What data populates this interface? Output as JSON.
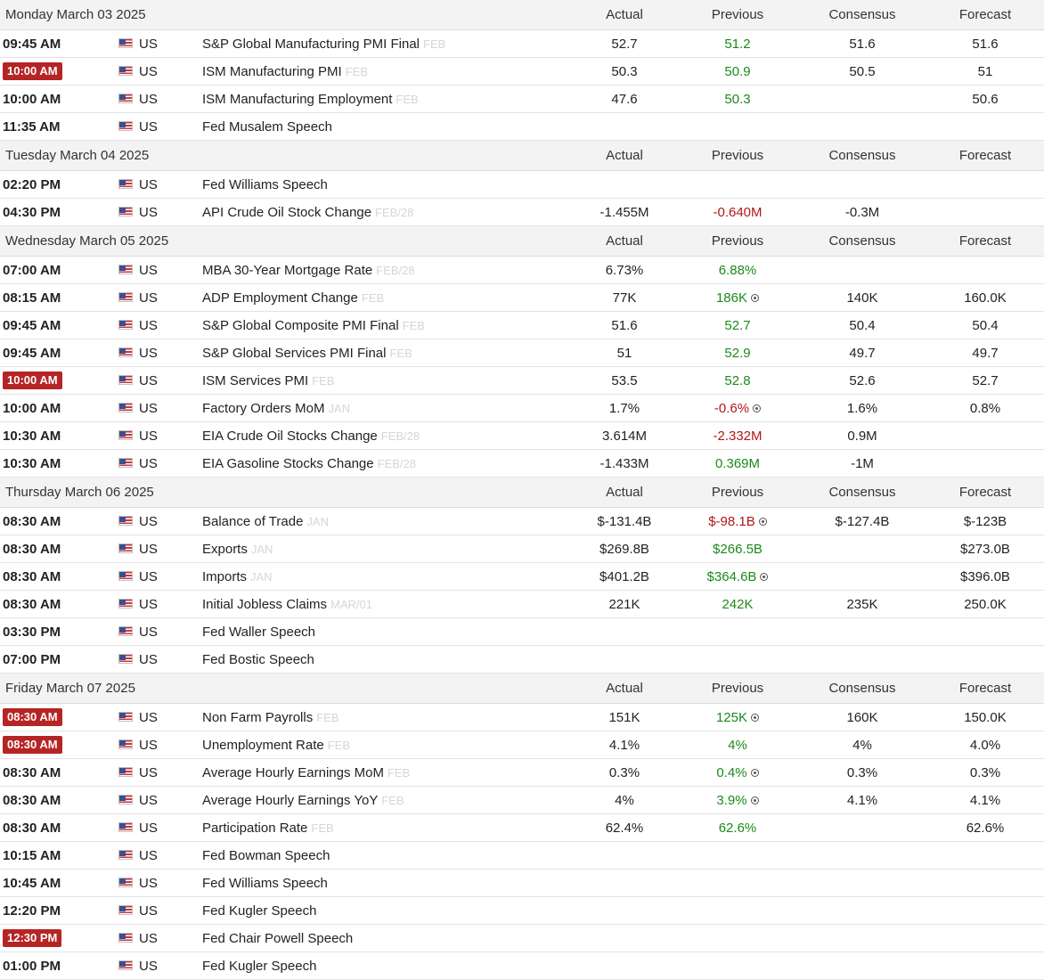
{
  "columns": {
    "actual": "Actual",
    "previous": "Previous",
    "consensus": "Consensus",
    "forecast": "Forecast"
  },
  "colors": {
    "highlight": "#b52525",
    "positive": "#1b8a1b",
    "negative": "#b01717"
  },
  "days": [
    {
      "date": "Monday March 03 2025",
      "events": [
        {
          "time": "09:45 AM",
          "highlight": false,
          "country": "US",
          "event": "S&P Global Manufacturing PMI Final",
          "ref": "FEB",
          "actual": "52.7",
          "previous": "51.2",
          "previous_color": "pos",
          "revised": false,
          "consensus": "51.6",
          "forecast": "51.6"
        },
        {
          "time": "10:00 AM",
          "highlight": true,
          "country": "US",
          "event": "ISM Manufacturing PMI",
          "ref": "FEB",
          "actual": "50.3",
          "previous": "50.9",
          "previous_color": "pos",
          "revised": false,
          "consensus": "50.5",
          "forecast": "51"
        },
        {
          "time": "10:00 AM",
          "highlight": false,
          "country": "US",
          "event": "ISM Manufacturing Employment",
          "ref": "FEB",
          "actual": "47.6",
          "previous": "50.3",
          "previous_color": "pos",
          "revised": false,
          "consensus": "",
          "forecast": "50.6"
        },
        {
          "time": "11:35 AM",
          "highlight": false,
          "country": "US",
          "event": "Fed Musalem Speech",
          "ref": "",
          "actual": "",
          "previous": "",
          "previous_color": "",
          "revised": false,
          "consensus": "",
          "forecast": ""
        }
      ]
    },
    {
      "date": "Tuesday March 04 2025",
      "events": [
        {
          "time": "02:20 PM",
          "highlight": false,
          "country": "US",
          "event": "Fed Williams Speech",
          "ref": "",
          "actual": "",
          "previous": "",
          "previous_color": "",
          "revised": false,
          "consensus": "",
          "forecast": ""
        },
        {
          "time": "04:30 PM",
          "highlight": false,
          "country": "US",
          "event": "API Crude Oil Stock Change",
          "ref": "FEB/28",
          "actual": "-1.455M",
          "previous": "-0.640M",
          "previous_color": "neg",
          "revised": false,
          "consensus": "-0.3M",
          "forecast": ""
        }
      ]
    },
    {
      "date": "Wednesday March 05 2025",
      "events": [
        {
          "time": "07:00 AM",
          "highlight": false,
          "country": "US",
          "event": "MBA 30-Year Mortgage Rate",
          "ref": "FEB/28",
          "actual": "6.73%",
          "previous": "6.88%",
          "previous_color": "pos",
          "revised": false,
          "consensus": "",
          "forecast": ""
        },
        {
          "time": "08:15 AM",
          "highlight": false,
          "country": "US",
          "event": "ADP Employment Change",
          "ref": "FEB",
          "actual": "77K",
          "previous": "186K",
          "previous_color": "pos",
          "revised": true,
          "consensus": "140K",
          "forecast": "160.0K"
        },
        {
          "time": "09:45 AM",
          "highlight": false,
          "country": "US",
          "event": "S&P Global Composite PMI Final",
          "ref": "FEB",
          "actual": "51.6",
          "previous": "52.7",
          "previous_color": "pos",
          "revised": false,
          "consensus": "50.4",
          "forecast": "50.4"
        },
        {
          "time": "09:45 AM",
          "highlight": false,
          "country": "US",
          "event": "S&P Global Services PMI Final",
          "ref": "FEB",
          "actual": "51",
          "previous": "52.9",
          "previous_color": "pos",
          "revised": false,
          "consensus": "49.7",
          "forecast": "49.7"
        },
        {
          "time": "10:00 AM",
          "highlight": true,
          "country": "US",
          "event": "ISM Services PMI",
          "ref": "FEB",
          "actual": "53.5",
          "previous": "52.8",
          "previous_color": "pos",
          "revised": false,
          "consensus": "52.6",
          "forecast": "52.7"
        },
        {
          "time": "10:00 AM",
          "highlight": false,
          "country": "US",
          "event": "Factory Orders MoM",
          "ref": "JAN",
          "actual": "1.7%",
          "previous": "-0.6%",
          "previous_color": "neg",
          "revised": true,
          "consensus": "1.6%",
          "forecast": "0.8%"
        },
        {
          "time": "10:30 AM",
          "highlight": false,
          "country": "US",
          "event": "EIA Crude Oil Stocks Change",
          "ref": "FEB/28",
          "actual": "3.614M",
          "previous": "-2.332M",
          "previous_color": "neg",
          "revised": false,
          "consensus": "0.9M",
          "forecast": ""
        },
        {
          "time": "10:30 AM",
          "highlight": false,
          "country": "US",
          "event": "EIA Gasoline Stocks Change",
          "ref": "FEB/28",
          "actual": "-1.433M",
          "previous": "0.369M",
          "previous_color": "pos",
          "revised": false,
          "consensus": "-1M",
          "forecast": ""
        }
      ]
    },
    {
      "date": "Thursday March 06 2025",
      "events": [
        {
          "time": "08:30 AM",
          "highlight": false,
          "country": "US",
          "event": "Balance of Trade",
          "ref": "JAN",
          "actual": "$-131.4B",
          "previous": "$-98.1B",
          "previous_color": "neg",
          "revised": true,
          "consensus": "$-127.4B",
          "forecast": "$-123B"
        },
        {
          "time": "08:30 AM",
          "highlight": false,
          "country": "US",
          "event": "Exports",
          "ref": "JAN",
          "actual": "$269.8B",
          "previous": "$266.5B",
          "previous_color": "pos",
          "revised": false,
          "consensus": "",
          "forecast": "$273.0B"
        },
        {
          "time": "08:30 AM",
          "highlight": false,
          "country": "US",
          "event": "Imports",
          "ref": "JAN",
          "actual": "$401.2B",
          "previous": "$364.6B",
          "previous_color": "pos",
          "revised": true,
          "consensus": "",
          "forecast": "$396.0B"
        },
        {
          "time": "08:30 AM",
          "highlight": false,
          "country": "US",
          "event": "Initial Jobless Claims",
          "ref": "MAR/01",
          "actual": "221K",
          "previous": "242K",
          "previous_color": "pos",
          "revised": false,
          "consensus": "235K",
          "forecast": "250.0K"
        },
        {
          "time": "03:30 PM",
          "highlight": false,
          "country": "US",
          "event": "Fed Waller Speech",
          "ref": "",
          "actual": "",
          "previous": "",
          "previous_color": "",
          "revised": false,
          "consensus": "",
          "forecast": ""
        },
        {
          "time": "07:00 PM",
          "highlight": false,
          "country": "US",
          "event": "Fed Bostic Speech",
          "ref": "",
          "actual": "",
          "previous": "",
          "previous_color": "",
          "revised": false,
          "consensus": "",
          "forecast": ""
        }
      ]
    },
    {
      "date": "Friday March 07 2025",
      "events": [
        {
          "time": "08:30 AM",
          "highlight": true,
          "country": "US",
          "event": "Non Farm Payrolls",
          "ref": "FEB",
          "actual": "151K",
          "previous": "125K",
          "previous_color": "pos",
          "revised": true,
          "consensus": "160K",
          "forecast": "150.0K"
        },
        {
          "time": "08:30 AM",
          "highlight": true,
          "country": "US",
          "event": "Unemployment Rate",
          "ref": "FEB",
          "actual": "4.1%",
          "previous": "4%",
          "previous_color": "pos",
          "revised": false,
          "consensus": "4%",
          "forecast": "4.0%"
        },
        {
          "time": "08:30 AM",
          "highlight": false,
          "country": "US",
          "event": "Average Hourly Earnings MoM",
          "ref": "FEB",
          "actual": "0.3%",
          "previous": "0.4%",
          "previous_color": "pos",
          "revised": true,
          "consensus": "0.3%",
          "forecast": "0.3%"
        },
        {
          "time": "08:30 AM",
          "highlight": false,
          "country": "US",
          "event": "Average Hourly Earnings YoY",
          "ref": "FEB",
          "actual": "4%",
          "previous": "3.9%",
          "previous_color": "pos",
          "revised": true,
          "consensus": "4.1%",
          "forecast": "4.1%"
        },
        {
          "time": "08:30 AM",
          "highlight": false,
          "country": "US",
          "event": "Participation Rate",
          "ref": "FEB",
          "actual": "62.4%",
          "previous": "62.6%",
          "previous_color": "pos",
          "revised": false,
          "consensus": "",
          "forecast": "62.6%"
        },
        {
          "time": "10:15 AM",
          "highlight": false,
          "country": "US",
          "event": "Fed Bowman Speech",
          "ref": "",
          "actual": "",
          "previous": "",
          "previous_color": "",
          "revised": false,
          "consensus": "",
          "forecast": ""
        },
        {
          "time": "10:45 AM",
          "highlight": false,
          "country": "US",
          "event": "Fed Williams Speech",
          "ref": "",
          "actual": "",
          "previous": "",
          "previous_color": "",
          "revised": false,
          "consensus": "",
          "forecast": ""
        },
        {
          "time": "12:20 PM",
          "highlight": false,
          "country": "US",
          "event": "Fed Kugler Speech",
          "ref": "",
          "actual": "",
          "previous": "",
          "previous_color": "",
          "revised": false,
          "consensus": "",
          "forecast": ""
        },
        {
          "time": "12:30 PM",
          "highlight": true,
          "country": "US",
          "event": "Fed Chair Powell Speech",
          "ref": "",
          "actual": "",
          "previous": "",
          "previous_color": "",
          "revised": false,
          "consensus": "",
          "forecast": ""
        },
        {
          "time": "01:00 PM",
          "highlight": false,
          "country": "US",
          "event": "Fed Kugler Speech",
          "ref": "",
          "actual": "",
          "previous": "",
          "previous_color": "",
          "revised": false,
          "consensus": "",
          "forecast": ""
        }
      ]
    }
  ]
}
